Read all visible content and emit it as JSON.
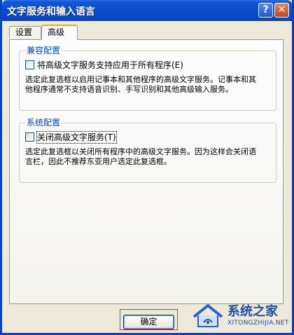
{
  "window": {
    "title": "文字服务和输入语言",
    "help_label": "?",
    "close_label": "✕"
  },
  "tabs": [
    {
      "label": "设置",
      "active": false
    },
    {
      "label": "高级",
      "active": true
    }
  ],
  "compat_group": {
    "title": "兼容配置",
    "checkbox_label": "将高级文字服务支持应用于所有程序(E)",
    "checked": false,
    "description": "选定此复选框以启用记事本和其他程序的高级文字服务。记事本和其他程序通常不支持语音识别、手写识别和其他高级输入服务。"
  },
  "system_group": {
    "title": "系统配置",
    "checkbox_label": "关闭高级文字服务(T)",
    "checked": false,
    "description": "选定此复选框以关闭所有程序中的高级文字服务。因为这样会关闭语言栏，因此不推荐东亚用户选定此复选框。"
  },
  "buttons": {
    "ok_label": "确定"
  },
  "watermark": {
    "name": "系统之家",
    "url": "XITONGZHIJIA.NET"
  },
  "colors": {
    "title_bar": "#0a4bd0",
    "group_title": "#0046d5",
    "highlight_box": "#d63a3a"
  }
}
